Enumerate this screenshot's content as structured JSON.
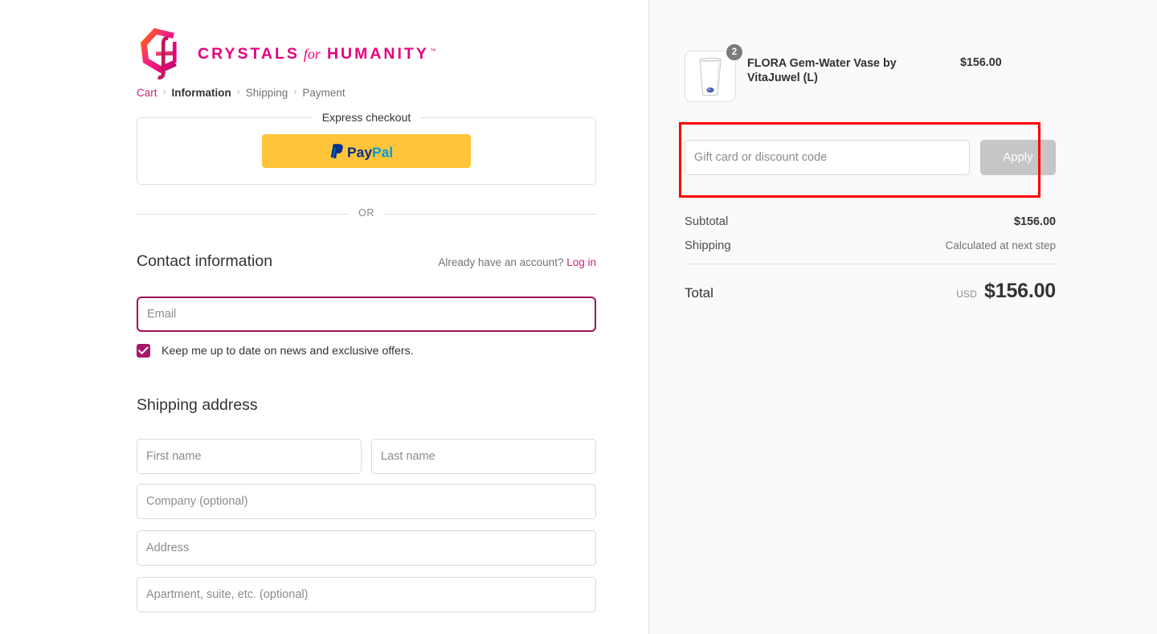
{
  "brand": {
    "logo_icon": "crystals-for-humanity-hexagon-monogram",
    "word1": "CRYSTALS",
    "word2": "for",
    "word3": "HUMANITY",
    "tm": "™",
    "color": "#e6007e"
  },
  "breadcrumb": {
    "separator": "›",
    "items": [
      {
        "label": "Cart",
        "state": "link"
      },
      {
        "label": "Information",
        "state": "current"
      },
      {
        "label": "Shipping",
        "state": "upcoming"
      },
      {
        "label": "Payment",
        "state": "upcoming"
      }
    ]
  },
  "express": {
    "legend": "Express checkout",
    "paypal_label": "PayPal",
    "paypal_bg": "#ffc439"
  },
  "divider": {
    "or_label": "OR"
  },
  "contact": {
    "title": "Contact information",
    "account_prefix": "Already have an account? ",
    "login_label": "Log in",
    "email_placeholder": "Email",
    "email_value": "",
    "newsletter_label": "Keep me up to date on news and exclusive offers.",
    "newsletter_checked": true,
    "accent_color": "#a81668"
  },
  "shipping": {
    "title": "Shipping address",
    "fields": [
      {
        "name": "first-name",
        "placeholder": "First name",
        "value": ""
      },
      {
        "name": "last-name",
        "placeholder": "Last name",
        "value": ""
      },
      {
        "name": "company",
        "placeholder": "Company (optional)",
        "value": ""
      },
      {
        "name": "address",
        "placeholder": "Address",
        "value": ""
      },
      {
        "name": "apartment",
        "placeholder": "Apartment, suite, etc. (optional)",
        "value": ""
      }
    ]
  },
  "summary": {
    "item": {
      "title": "FLORA Gem-Water Vase by VitaJuwel (L)",
      "price": "$156.00",
      "quantity": "2",
      "thumbnail_icon": "glass-vase-with-gem"
    },
    "discount": {
      "placeholder": "Gift card or discount code",
      "value": "",
      "apply_label": "Apply",
      "highlight_color": "#ff0000"
    },
    "lines": [
      {
        "label": "Subtotal",
        "value": "$156.00",
        "muted": false
      },
      {
        "label": "Shipping",
        "value": "Calculated at next step",
        "muted": true
      }
    ],
    "total": {
      "label": "Total",
      "currency": "USD",
      "amount": "$156.00"
    }
  }
}
